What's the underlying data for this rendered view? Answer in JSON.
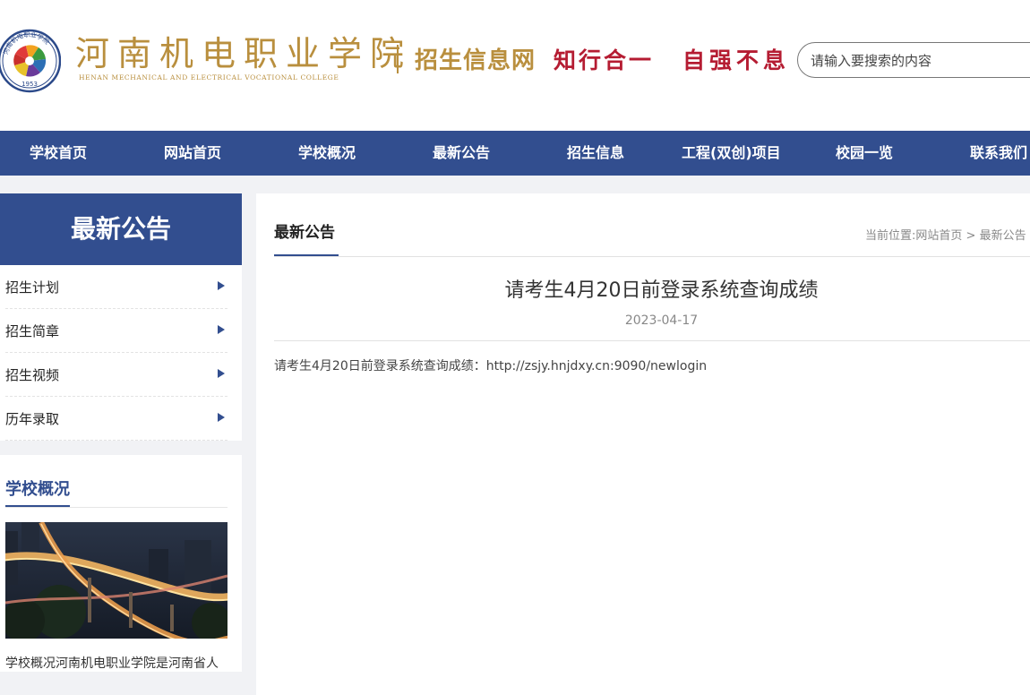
{
  "header": {
    "emblem_year": "1953",
    "emblem_text": "河南机电职业学院",
    "school_name": "河南机电职业学院",
    "school_name_en": "HENAN MECHANICAL AND ELECTRICAL VOCATIONAL COLLEGE",
    "site_name": "招生信息网",
    "motto_1": "知行合一",
    "motto_2": "自强不息",
    "search_placeholder": "请输入要搜索的内容"
  },
  "nav": {
    "items": [
      "学校首页",
      "网站首页",
      "学校概况",
      "最新公告",
      "招生信息",
      "工程(双创)项目",
      "校园一览",
      "联系我们"
    ]
  },
  "sidebar": {
    "heading": "最新公告",
    "items": [
      {
        "label": "招生计划"
      },
      {
        "label": "招生简章"
      },
      {
        "label": "招生视频"
      },
      {
        "label": "历年录取"
      }
    ]
  },
  "about": {
    "title": "学校概况",
    "text": "学校概况河南机电职业学院是河南省人"
  },
  "main": {
    "section_title": "最新公告",
    "breadcrumb_label": "当前位置:",
    "breadcrumb_home": "网站首页",
    "breadcrumb_sep": ">",
    "breadcrumb_current": "最新公告",
    "article_title": "请考生4月20日前登录系统查询成绩",
    "article_date": "2023-04-17",
    "article_body": "请考生4月20日前登录系统查询成绩：http://zsjy.hnjdxy.cn:9090/newlogin"
  },
  "colors": {
    "primary_blue": "#324e8f",
    "gold": "#b98f3e",
    "red": "#b51c32"
  },
  "icons": [
    "logo-emblem-icon",
    "arrow-right-icon"
  ]
}
